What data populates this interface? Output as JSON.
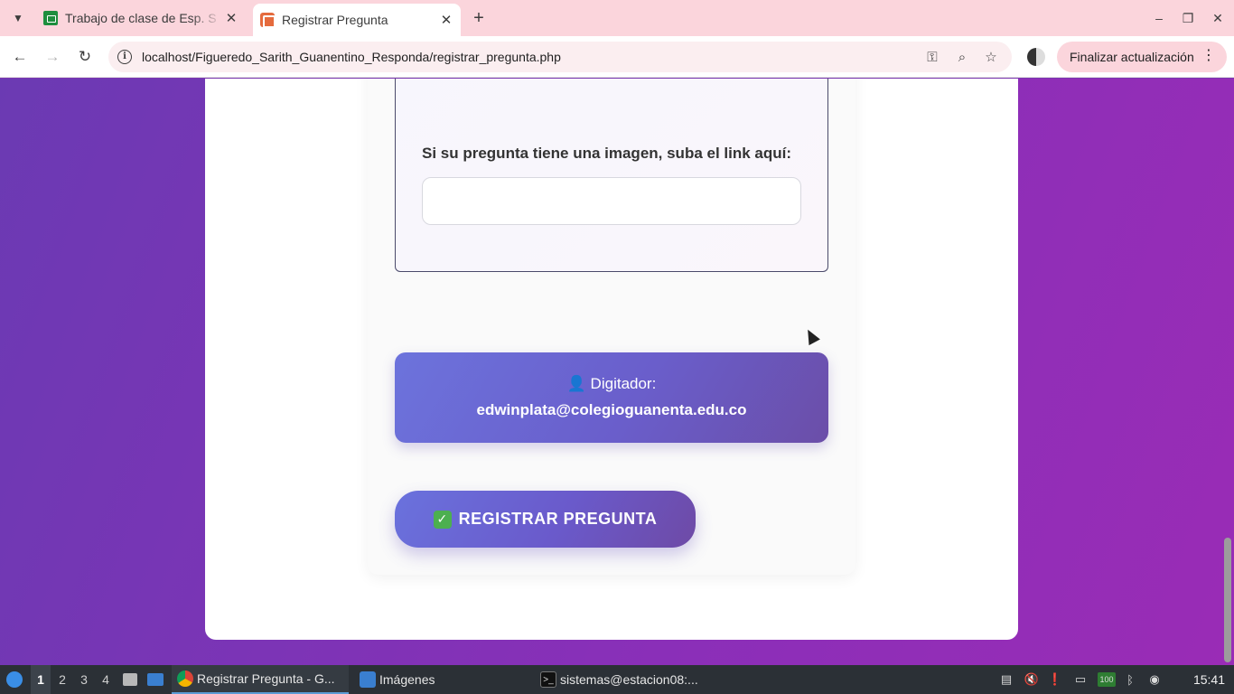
{
  "browser": {
    "tabs": [
      {
        "title": "Trabajo de clase de Esp. S",
        "active": false
      },
      {
        "title": "Registrar Pregunta",
        "active": true
      }
    ],
    "url": "localhost/Figueredo_Sarith_Guanentino_Responda/registrar_pregunta.php",
    "update_button": "Finalizar actualización"
  },
  "form": {
    "image_link_label": "Si su pregunta tiene una imagen, suba el link aquí:",
    "image_link_value": "",
    "digitador_label": "👤 Digitador:",
    "digitador_email": "edwinplata@colegioguanenta.edu.co",
    "submit_label": "REGISTRAR PREGUNTA"
  },
  "taskbar": {
    "workspaces": [
      "1",
      "2",
      "3",
      "4"
    ],
    "apps": [
      {
        "label": "Registrar Pregunta - G...",
        "active": true
      },
      {
        "label": "Imágenes",
        "active": false
      },
      {
        "label": "sistemas@estacion08:...",
        "active": false
      }
    ],
    "clock": "15:41"
  },
  "colors": {
    "page_bg": "#7a36b0",
    "accent_gradient_start": "#6c73dc",
    "accent_gradient_end": "#6b4ea8",
    "tabbar_bg": "#fbd5dc"
  }
}
